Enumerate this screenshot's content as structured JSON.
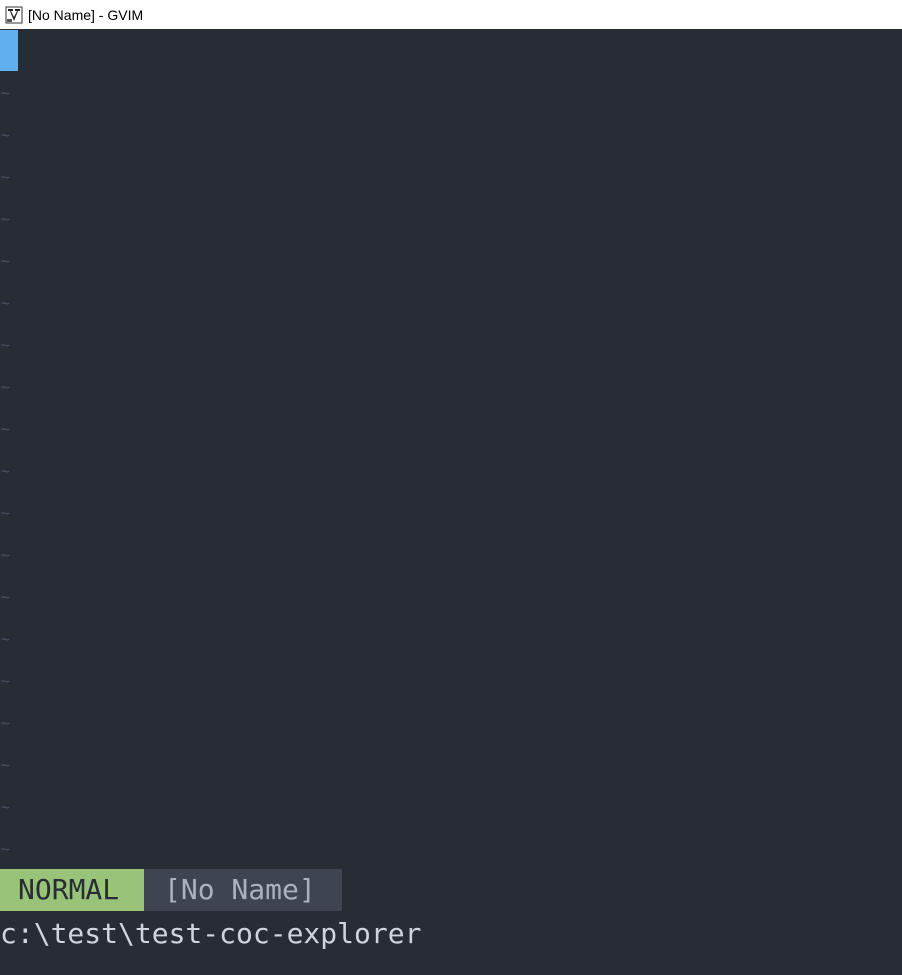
{
  "window": {
    "title": "[No Name] - GVIM",
    "app_icon": "gvim-icon"
  },
  "editor": {
    "empty_line_marker": "~",
    "empty_line_count": 19,
    "cursor_color": "#61afef",
    "background": "#282c34"
  },
  "statusline": {
    "mode": "NORMAL",
    "filename": "[No Name]",
    "mode_color": "#98c379",
    "filename_bg": "#3e4452"
  },
  "cmdline": {
    "text": "c:\\test\\test-coc-explorer"
  }
}
